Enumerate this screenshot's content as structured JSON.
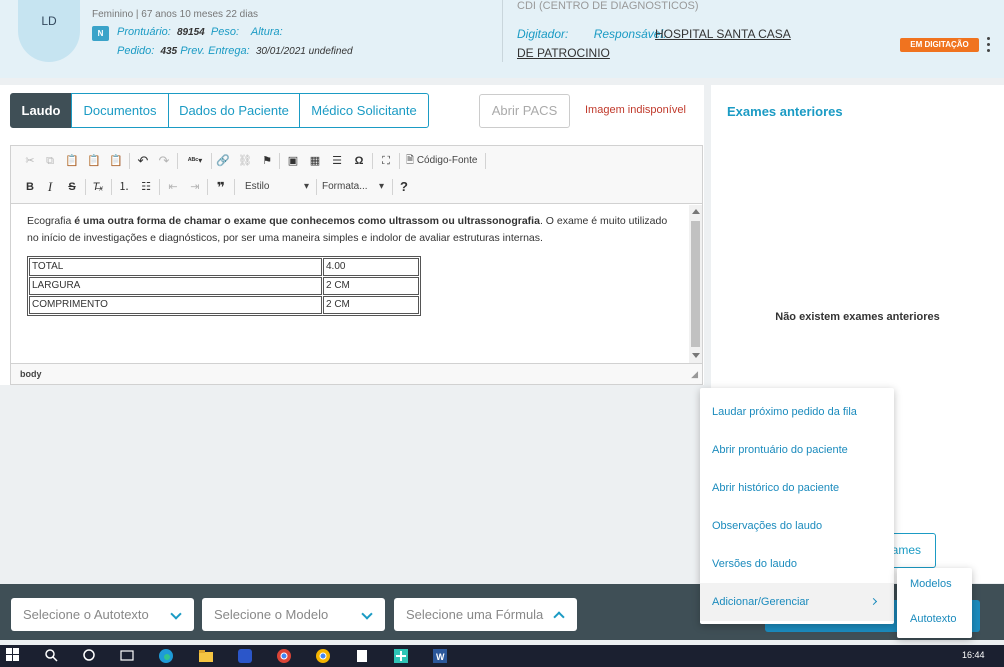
{
  "header": {
    "avatar_initials": "LD",
    "patient_line1": "Feminino | 67 anos 10 meses 22 dias",
    "badge": "N",
    "prontuario_label": "Prontuário:",
    "prontuario_value": "89154",
    "peso_label": "Peso:",
    "peso_value": "",
    "altura_label": "Altura:",
    "altura_value": "",
    "pedido_label": "Pedido:",
    "pedido_value": "435",
    "prev_label": "Prev. Entrega:",
    "prev_value": "30/01/2021 undefined",
    "cdi": "CDI (CENTRO DE DIAGNOSTICOS)",
    "digitador_label": "Digitador:",
    "responsavel_label": "Responsável:",
    "responsavel_line1": "HOSPITAL SANTA CASA",
    "responsavel_line2": "DE PATROCINIO",
    "status": "EM DIGITAÇÃO"
  },
  "tabs": [
    "Laudo",
    "Documentos",
    "Dados do Paciente",
    "Médico Solicitante"
  ],
  "actions": {
    "abrir_pacs": "Abrir PACS",
    "imagem_indisponivel": "Imagem indisponível"
  },
  "editor": {
    "toolbar_source": "Código-Fonte",
    "estilo": "Estilo",
    "formato": "Formata...",
    "paragraph": {
      "p1": "Ecografia ",
      "b1": "é uma outra forma de chamar",
      "p2": " o exame que conhecemos como ",
      "b2": "ultrassom",
      "p3": " ou ",
      "b3": "ultrassonografia",
      "p4": ". O exame é muito utilizado no início de investigações e diagnósticos, por ser uma maneira simples e indolor de avaliar estruturas internas."
    },
    "table": [
      [
        "TOTAL",
        "4.00"
      ],
      [
        "LARGURA",
        "2 CM"
      ],
      [
        "COMPRIMENTO",
        "2 CM"
      ]
    ],
    "status_path": "body"
  },
  "right_panel": {
    "title": "Exames anteriores",
    "empty": "Não existem exames anteriores",
    "button_partial": "ames"
  },
  "bottom": {
    "autotexto_placeholder": "Selecione o Autotexto",
    "modelo_placeholder": "Selecione o Modelo",
    "formula_placeholder": "Selecione uma Fórmula"
  },
  "menu": {
    "items": [
      "Laudar próximo pedido da fila",
      "Abrir prontuário do paciente",
      "Abrir histórico do paciente",
      "Observações do laudo",
      "Versões do laudo",
      "Adicionar/Gerenciar"
    ],
    "submenu": [
      "Modelos",
      "Autotexto"
    ]
  },
  "taskbar": {
    "time": "16:44"
  },
  "colors": {
    "accent": "#1b9bc4",
    "dark": "#3f4f56",
    "status": "#f0731f",
    "error": "#c0392b"
  }
}
